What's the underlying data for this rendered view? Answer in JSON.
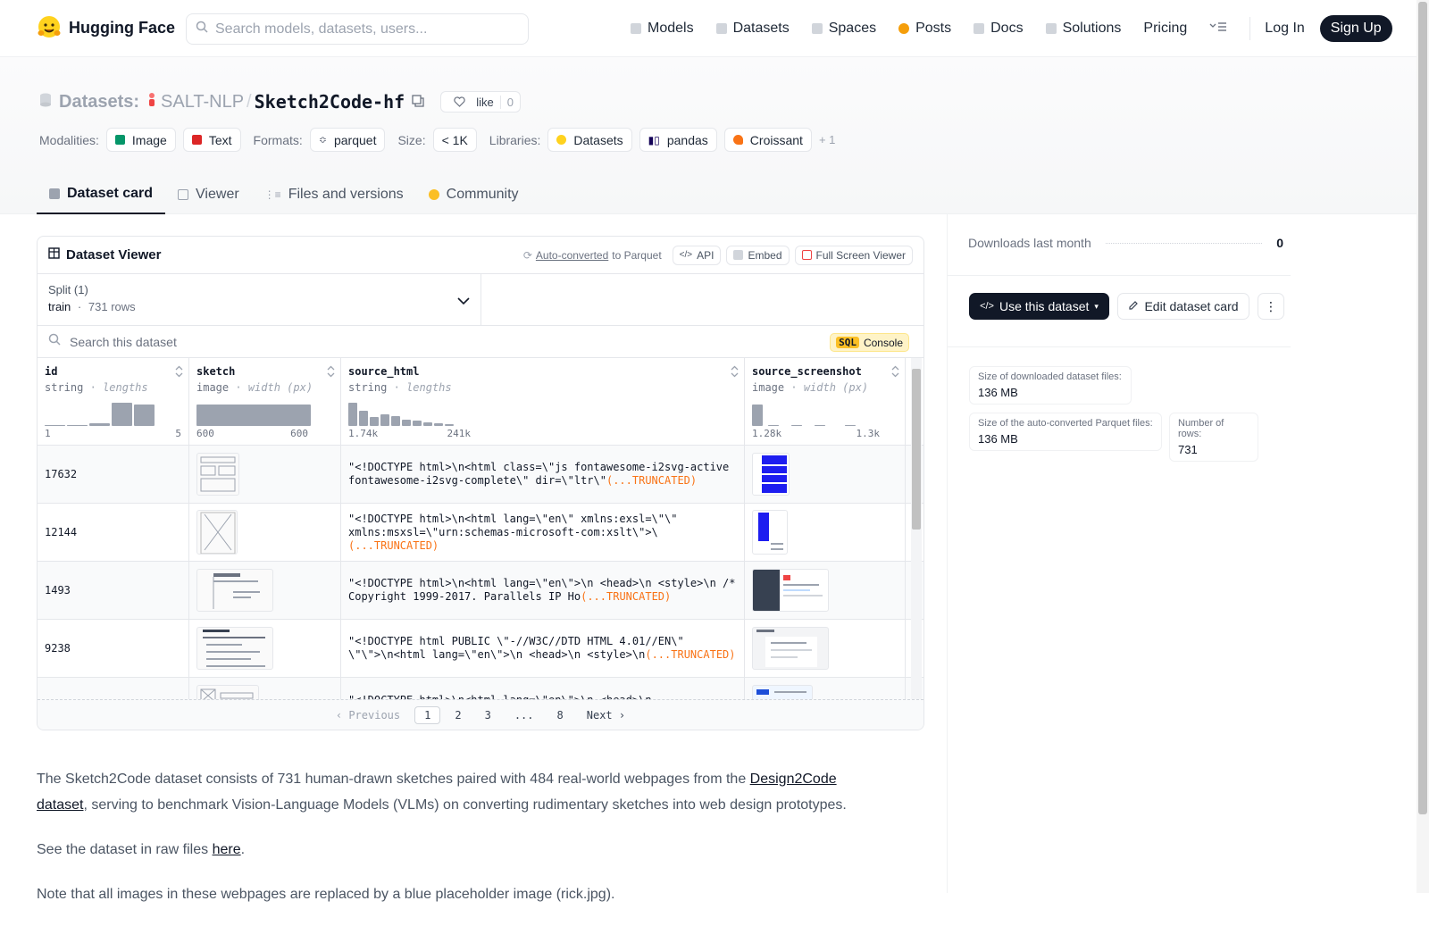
{
  "nav": {
    "brand": "Hugging Face",
    "search_placeholder": "Search models, datasets, users...",
    "links": [
      "Models",
      "Datasets",
      "Spaces",
      "Posts",
      "Docs",
      "Solutions",
      "Pricing"
    ],
    "login": "Log In",
    "signup": "Sign Up"
  },
  "header": {
    "section": "Datasets:",
    "org": "SALT-NLP",
    "slash": "/",
    "name": "Sketch2Code-hf",
    "like_label": "like",
    "like_count": "0",
    "modalities_label": "Modalities:",
    "modalities": [
      "Image",
      "Text"
    ],
    "formats_label": "Formats:",
    "format": "parquet",
    "size_label": "Size:",
    "size": "< 1K",
    "libraries_label": "Libraries:",
    "libraries": [
      "Datasets",
      "pandas",
      "Croissant"
    ],
    "libraries_more": "+ 1",
    "tabs": [
      "Dataset card",
      "Viewer",
      "Files and versions",
      "Community"
    ]
  },
  "viewer": {
    "title": "Dataset Viewer",
    "autoconv_link": "Auto-converted",
    "autoconv_rest": "to Parquet",
    "api": "API",
    "embed": "Embed",
    "fullscreen": "Full Screen Viewer",
    "split_label": "Split (1)",
    "split_name": "train",
    "split_sep": "·",
    "split_rows": "731 rows",
    "search_placeholder": "Search this dataset",
    "sql_tag": "SQL",
    "sql_label": "Console",
    "columns": [
      {
        "name": "id",
        "type": "string",
        "stat": "lengths",
        "min": "1",
        "max": "5"
      },
      {
        "name": "sketch",
        "type": "image",
        "stat": "width (px)",
        "min": "600",
        "max": "600"
      },
      {
        "name": "source_html",
        "type": "string",
        "stat": "lengths",
        "min": "1.74k",
        "max": "241k"
      },
      {
        "name": "source_screenshot",
        "type": "image",
        "stat": "width (px)",
        "min": "1.28k",
        "max": "1.3k"
      }
    ],
    "stat_sep": "·",
    "truncated": "(...TRUNCATED)",
    "rows": [
      {
        "id": "17632",
        "html": "\"<!DOCTYPE html>\\n<html class=\\\"js fontawesome-i2svg-active fontawesome-i2svg-complete\\\" dir=\\\"ltr\\\""
      },
      {
        "id": "12144",
        "html": "\"<!DOCTYPE html>\\n<html lang=\\\"en\\\" xmlns:exsl=\\\"\\\" xmlns:msxsl=\\\"urn:schemas-microsoft-com:xslt\\\">\\"
      },
      {
        "id": "1493",
        "html": "\"<!DOCTYPE html>\\n<html lang=\\\"en\\\">\\n <head>\\n <style>\\n /* Copyright 1999-2017. Parallels IP Ho"
      },
      {
        "id": "9238",
        "html": "\"<!DOCTYPE html PUBLIC \\\"-//W3C//DTD HTML 4.01//EN\\\" \\\"\\\">\\n<html lang=\\\"en\\\">\\n <head>\\n <style>\\n"
      },
      {
        "id": "",
        "html": "\"<!DOCTYPE html>\\n<html lang=\\\"en\\\">\\n <head>\\n <style>\\n\\n/*"
      }
    ],
    "pager": {
      "prev": "Previous",
      "pages": [
        "1",
        "2",
        "3",
        "...",
        "8"
      ],
      "next": "Next"
    }
  },
  "prose": {
    "p1_a": "The Sketch2Code dataset consists of 731 human-drawn sketches paired with 484 real-world webpages from the ",
    "p1_link": "Design2Code dataset",
    "p1_b": ", serving to benchmark Vision-Language Models (VLMs) on converting rudimentary sketches into web design prototypes.",
    "p2_a": "See the dataset in raw files ",
    "p2_link": "here",
    "p2_b": ".",
    "p3": "Note that all images in these webpages are replaced by a blue placeholder image (rick.jpg)."
  },
  "sidebar": {
    "downloads_label": "Downloads last month",
    "downloads_value": "0",
    "use_btn": "Use this dataset",
    "edit_btn": "Edit dataset card",
    "stats": [
      {
        "label": "Size of downloaded dataset files:",
        "value": "136 MB"
      },
      {
        "label": "Size of the auto-converted Parquet files:",
        "value": "136 MB"
      },
      {
        "label": "Number of rows:",
        "value": "731"
      }
    ]
  },
  "colors": {
    "accent": "#111827",
    "truncated": "#f97316",
    "brand_yellow": "#FFD21E"
  }
}
